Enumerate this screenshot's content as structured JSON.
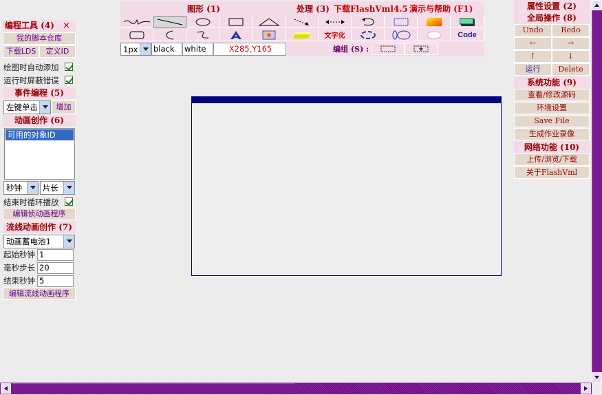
{
  "left_panel": {
    "edit_tools_title": "编程工具 (4)",
    "close_glyph": "×",
    "my_repo": "我的脚本仓库",
    "download_lds": "下载LDS",
    "define_id": "定义ID",
    "auto_add_label": "绘图时自动添加",
    "mask_errors_label": "运行时屏蔽错误",
    "event_title": "事件编程 (5)",
    "event_select": "左键单击",
    "add_button": "增加",
    "anim_title": "动画创作 (6)",
    "object_list_item": "可用的对象ID",
    "unit_select": "秒钟",
    "length_select": "片长",
    "loop_label": "结束时循环播放",
    "edit_frame_anim": "编辑侦动画程序",
    "stream_title": "流线动画创作 (7)",
    "stream_select": "动画蓄电池1",
    "start_sec_label": "起始秒钟",
    "start_sec_value": "1",
    "step_label": "毫秒步长",
    "step_value": "20",
    "end_sec_label": "结束秒钟",
    "end_sec_value": "5",
    "edit_stream_anim": "编辑流线动画程序"
  },
  "toolbar": {
    "shapes_menu": "图形 (1)",
    "process_menu": "处理 (3)",
    "download_menu": "下载FlashVml4.5",
    "demo_help_menu": "演示与帮助 (F1)",
    "text_tool": "文字化",
    "code_tool": "Code",
    "stroke_width": "1px",
    "stroke_color": "black",
    "fill_color": "white",
    "coords": "X285,Y165",
    "group_label": "编组 (S) :"
  },
  "right_panel": {
    "props_title": "属性设置 (2)",
    "global_title": "全局操作 (8)",
    "undo": "Undo",
    "redo": "Redo",
    "left_arrow": "←",
    "right_arrow": "→",
    "up_arrow": "↑",
    "down_arrow": "↓",
    "run": "运行",
    "delete": "Delete",
    "system_title": "系统功能 (9)",
    "view_source": "查看/修改源码",
    "env_settings": "环境设置",
    "save_file": "Save File",
    "gen_record": "生成作业录像",
    "network_title": "网络功能 (10)",
    "upload_browse": "上传/浏览/下载",
    "about": "关于FlashVml"
  },
  "colors": {
    "panel_bg": "#f4dbe8",
    "button_bg": "#e4d8cc",
    "title_red": "#990000",
    "link_purple": "#660099",
    "canvas_border": "#000080",
    "scroll_purple": "#6a0080"
  }
}
